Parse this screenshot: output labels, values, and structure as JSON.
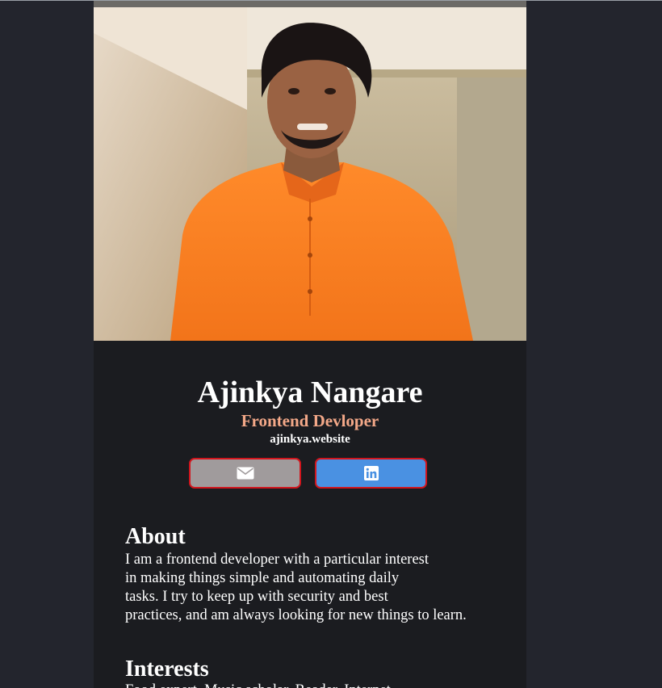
{
  "profile": {
    "photo_icon": "person-photo",
    "name": "Ajinkya Nangare",
    "role": "Frontend Devloper",
    "website": "ajinkya.website"
  },
  "buttons": {
    "email_icon": "envelope-icon",
    "linkedin_icon": "linkedin-icon"
  },
  "about": {
    "title": "About",
    "lines": [
      "I am a frontend developer with a particular interest",
      "in making things simple and automating daily",
      "tasks. I try to keep up with security and best",
      "practices, and am always looking for new things to learn."
    ]
  },
  "interests": {
    "title": "Interests",
    "text": "Food expert. Music scholar. Reader. Internet"
  },
  "colors": {
    "page_bg": "#23252d",
    "card_bg": "#1b1c20",
    "role_accent": "#f3a888",
    "email_button": "#a09b9c",
    "linkedin_button": "#4a91e2",
    "button_border": "#d2151d"
  }
}
